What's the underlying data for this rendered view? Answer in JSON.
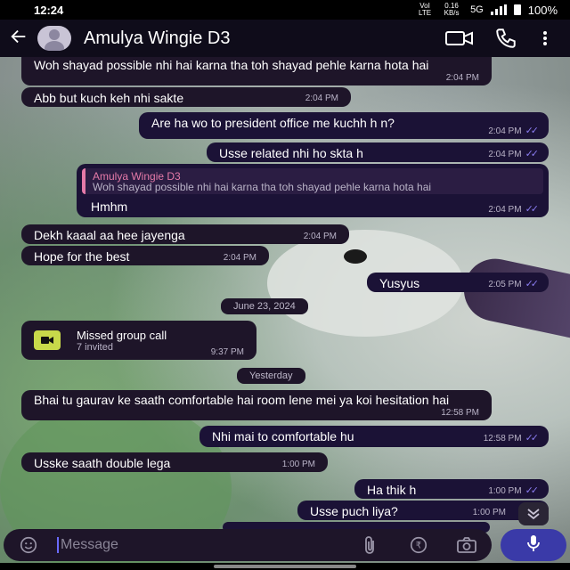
{
  "status": {
    "time": "12:24",
    "volte": "VoI LTE",
    "speed": "0.16 KB/s",
    "network": "5G",
    "battery": "100%"
  },
  "header": {
    "back_icon": "arrow-left-icon",
    "contact_name": "Amulya Wingie D3",
    "video_icon": "video-camera-icon",
    "call_icon": "phone-icon",
    "menu_icon": "more-vertical-icon"
  },
  "messages": [
    {
      "text": "Woh shayad possible nhi hai karna tha toh shayad pehle karna hota hai",
      "time": "2:04 PM",
      "dir": "in"
    },
    {
      "text": "Abb but kuch keh nhi sakte",
      "time": "2:04 PM",
      "dir": "in"
    },
    {
      "text": "Are ha wo to president office me kuchh h n?",
      "time": "2:04 PM",
      "dir": "out"
    },
    {
      "text": "Usse related nhi ho skta h",
      "time": "2:04 PM",
      "dir": "out"
    },
    {
      "reply_name": "Amulya Wingie D3",
      "reply_text": "Woh shayad possible nhi hai karna tha toh shayad pehle karna hota hai",
      "text": "Hmhm",
      "time": "2:04 PM",
      "dir": "out"
    },
    {
      "text": "Dekh kaaal aa hee jayenga",
      "time": "2:04 PM",
      "dir": "in"
    },
    {
      "text": "Hope for the best",
      "time": "2:04 PM",
      "dir": "in"
    },
    {
      "text": "Yusyus",
      "time": "2:05 PM",
      "dir": "out"
    },
    {
      "text": "Bhai tu gaurav ke saath comfortable hai room lene mei ya koi hesitation hai",
      "time": "12:58 PM",
      "dir": "in"
    },
    {
      "text": "Nhi mai to comfortable hu",
      "time": "12:58 PM",
      "dir": "out"
    },
    {
      "text": "Usske saath double lega",
      "time": "1:00 PM",
      "dir": "in"
    },
    {
      "text": "Ha thik h",
      "time": "1:00 PM",
      "dir": "out"
    },
    {
      "text": "Usse puch liya?",
      "time": "1:00 PM",
      "dir": "out"
    }
  ],
  "dates": {
    "d1": "June 23, 2024",
    "d2": "Yesterday"
  },
  "missed_call": {
    "title": "Missed group call",
    "subtitle": "7 invited",
    "time": "9:37 PM",
    "icon": "video-call-missed-icon"
  },
  "input": {
    "placeholder": "Message",
    "emoji_icon": "emoji-icon",
    "attach_icon": "paperclip-icon",
    "payment_icon": "rupee-icon",
    "camera_icon": "camera-icon",
    "mic_icon": "microphone-icon"
  },
  "colors": {
    "bubble_in": "#1e1529",
    "bubble_out": "#1b1236",
    "read_ticks": "#8a7cf0",
    "mic_button": "#3a3aa8"
  }
}
